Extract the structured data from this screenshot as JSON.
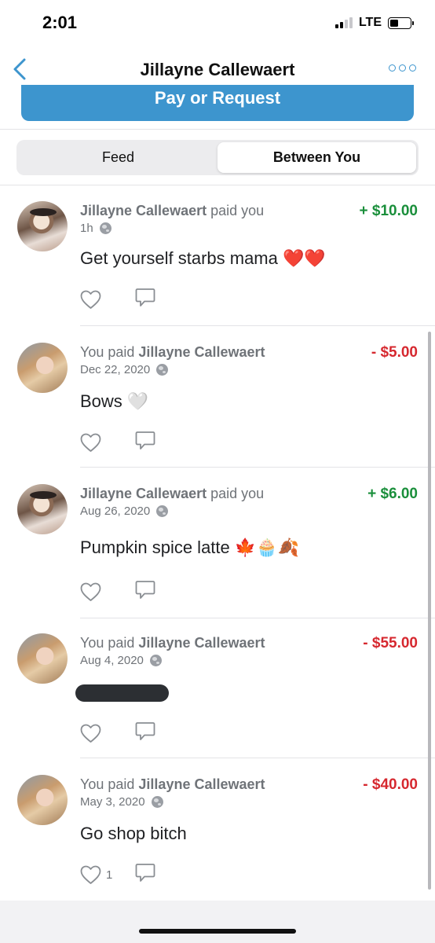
{
  "status_bar": {
    "time": "2:01",
    "network": "LTE",
    "signal_bars": 2,
    "signal_total": 4
  },
  "nav": {
    "title": "Jillayne Callewaert"
  },
  "pay_button": {
    "label": "Pay or Request"
  },
  "tabs": [
    {
      "label": "Feed",
      "active": false
    },
    {
      "label": "Between You",
      "active": true
    }
  ],
  "feed": [
    {
      "pre": "",
      "name": "Jillayne Callewaert",
      "post": " paid you",
      "amount": "+ $10.00",
      "direction": "in",
      "time": "1h",
      "message": "Get yourself starbs mama ❤️❤️",
      "likes": ""
    },
    {
      "pre": "You paid ",
      "name": "Jillayne Callewaert",
      "post": "",
      "amount": "- $5.00",
      "direction": "out",
      "time": "Dec 22, 2020",
      "message": "Bows 🤍",
      "likes": ""
    },
    {
      "pre": "",
      "name": "Jillayne Callewaert",
      "post": " paid you",
      "amount": "+ $6.00",
      "direction": "in",
      "time": "Aug 26, 2020",
      "message": "Pumpkin spice latte 🍁🧁🍂",
      "likes": ""
    },
    {
      "pre": "You paid ",
      "name": "Jillayne Callewaert",
      "post": "",
      "amount": "- $55.00",
      "direction": "out",
      "time": "Aug 4, 2020",
      "message": "",
      "likes": ""
    },
    {
      "pre": "You paid ",
      "name": "Jillayne Callewaert",
      "post": "",
      "amount": "- $40.00",
      "direction": "out",
      "time": "May 3, 2020",
      "message": "Go shop bitch",
      "likes": "1"
    }
  ]
}
